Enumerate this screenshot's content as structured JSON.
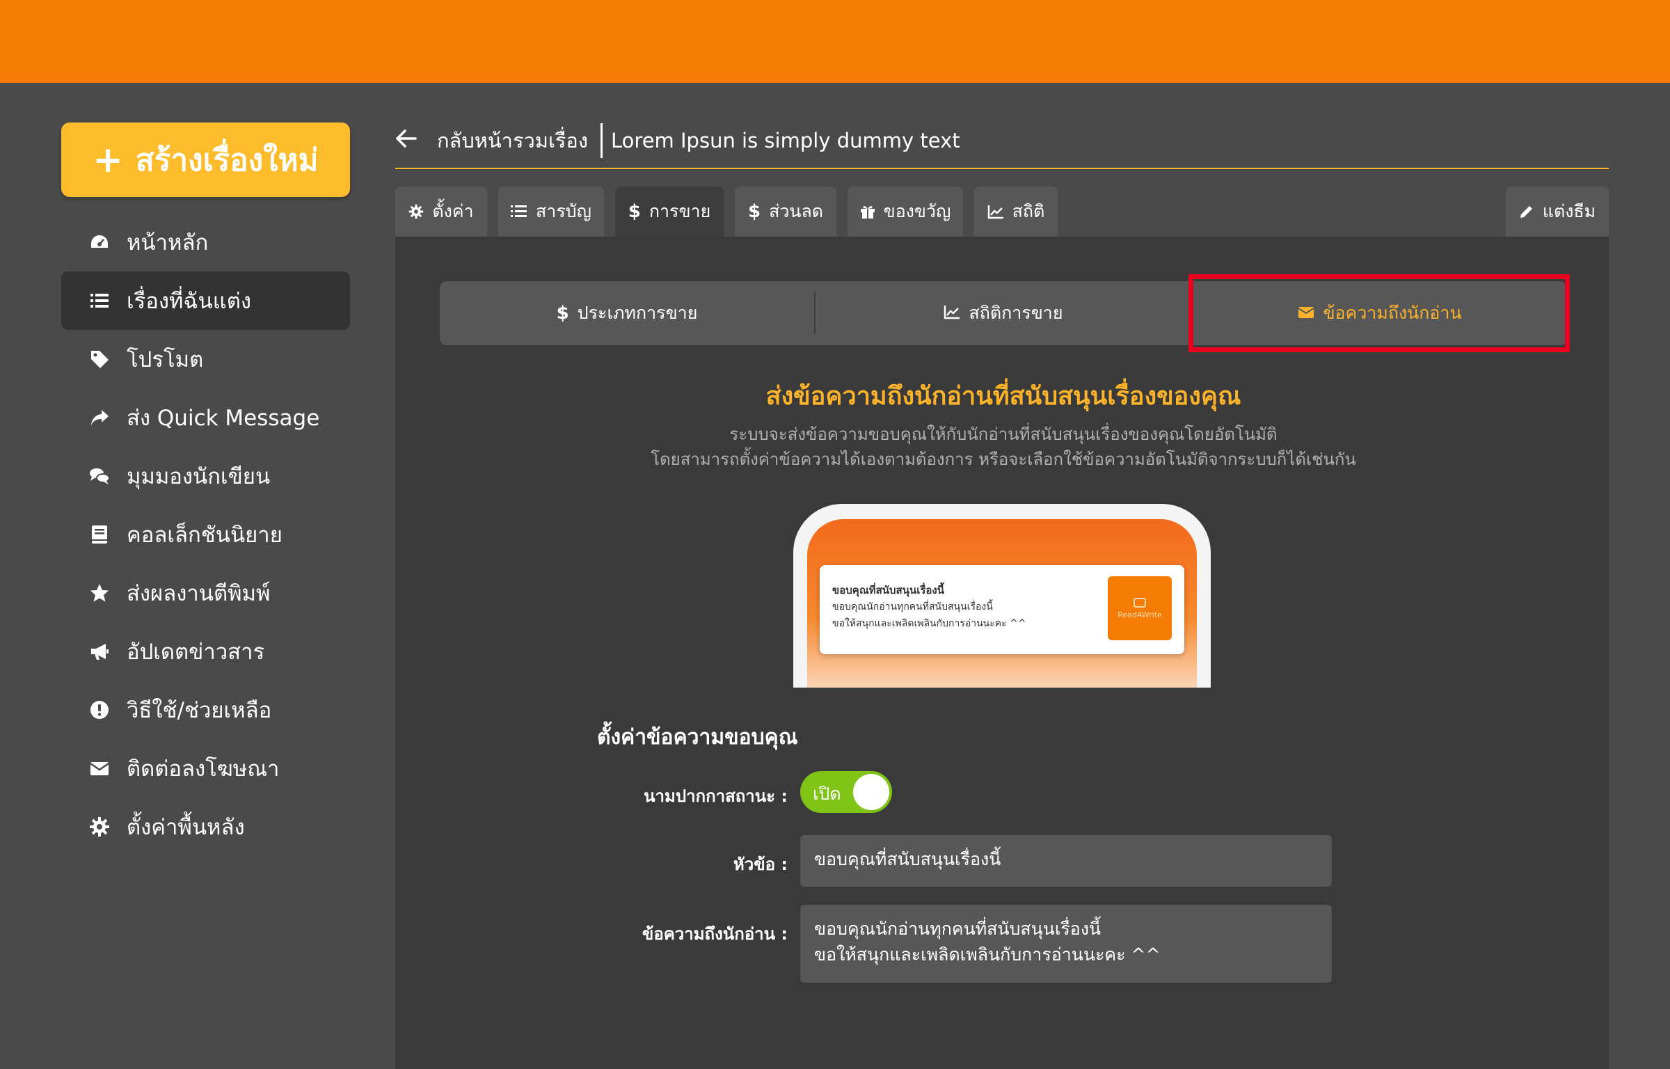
{
  "sidebar": {
    "create_label": "สร้างเรื่องใหม่",
    "items": [
      {
        "label": "หน้าหลัก",
        "icon": "dashboard-icon"
      },
      {
        "label": "เรื่องที่ฉันแต่ง",
        "icon": "list-icon",
        "active": true
      },
      {
        "label": "โปรโมต",
        "icon": "tag-icon"
      },
      {
        "label": "ส่ง Quick Message",
        "icon": "share-icon"
      },
      {
        "label": "มุมมองนักเขียน",
        "icon": "comments-icon"
      },
      {
        "label": "คอลเล็กชันนิยาย",
        "icon": "book-icon"
      },
      {
        "label": "ส่งผลงานตีพิมพ์",
        "icon": "star-icon"
      },
      {
        "label": "อัปเดตข่าวสาร",
        "icon": "megaphone-icon"
      },
      {
        "label": "วิธีใช้/ช่วยเหลือ",
        "icon": "alert-circle-icon"
      },
      {
        "label": "ติดต่อลงโฆษณา",
        "icon": "envelope-icon"
      },
      {
        "label": "ตั้งค่าพื้นหลัง",
        "icon": "gear-icon"
      }
    ]
  },
  "header": {
    "back_label": "กลับหน้ารวมเรื่อง",
    "story_title": "Lorem Ipsun is simply dummy text"
  },
  "tabs": [
    {
      "label": "ตั้งค่า",
      "icon": "gear-icon"
    },
    {
      "label": "สารบัญ",
      "icon": "list-ol-icon"
    },
    {
      "label": "การขาย",
      "icon": "dollar-icon",
      "active": true
    },
    {
      "label": "ส่วนลด",
      "icon": "dollar-icon"
    },
    {
      "label": "ของขวัญ",
      "icon": "gift-icon"
    },
    {
      "label": "สถิติ",
      "icon": "line-chart-icon"
    }
  ],
  "theme_tab": {
    "label": "แต่งธีม",
    "icon": "pencil-icon"
  },
  "subtabs": [
    {
      "label": "ประเภทการขาย",
      "icon": "dollar-icon"
    },
    {
      "label": "สถิติการขาย",
      "icon": "line-chart-icon"
    },
    {
      "label": "ข้อความถึงนักอ่าน",
      "icon": "envelope-icon",
      "active": true
    }
  ],
  "intro": {
    "title": "ส่งข้อความถึงนักอ่านที่สนับสนุนเรื่องของคุณ",
    "desc_line1": "ระบบจะส่งข้อความขอบคุณให้กับนักอ่านที่สนับสนุนเรื่องของคุณโดยอัตโนมัติ",
    "desc_line2": "โดยสามารถตั้งค่าข้อความได้เองตามต้องการ หรือจะเลือกใช้ข้อความอัตโนมัติจากระบบก็ได้เช่นกัน"
  },
  "preview": {
    "title": "ขอบคุณที่สนับสนุนเรื่องนี้",
    "line1": "ขอบคุณนักอ่านทุกคนที่สนับสนุนเรื่องนี้",
    "line2": "ขอให้สนุกและเพลิดเพลินกับการอ่านนะคะ ^^",
    "logo_text": "ReadAWrite"
  },
  "form": {
    "section_title": "ตั้งค่าข้อความขอบคุณ",
    "anonymous_label": "นามปากกาสถานะ :",
    "toggle_label": "เปิด",
    "toggle_on": true,
    "subject_label": "หัวข้อ :",
    "subject_value": "ขอบคุณที่สนับสนุนเรื่องนี้",
    "message_label": "ข้อความถึงนักอ่าน :",
    "message_line1": "ขอบคุณนักอ่านทุกคนที่สนับสนุนเรื่องนี้",
    "message_line2": "ขอให้สนุกและเพลิดเพลินกับการอ่านนะคะ ^^"
  },
  "colors": {
    "topbar": "#f57c04",
    "accent": "#fcb32c",
    "highlight_box": "#e8001f",
    "toggle_on": "#7fc416"
  }
}
